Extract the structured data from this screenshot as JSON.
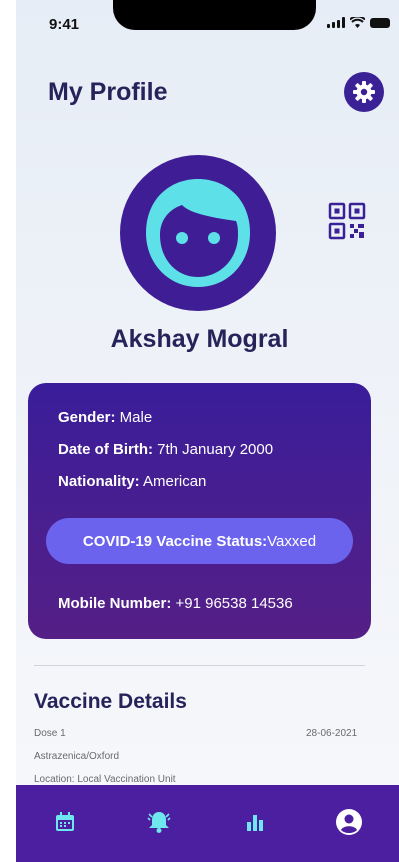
{
  "status_bar": {
    "time": "9:41"
  },
  "header": {
    "title": "My Profile"
  },
  "profile": {
    "name": "Akshay Mogral"
  },
  "info_card": {
    "gender_label": "Gender:",
    "gender_value": " Male",
    "dob_label": "Date of Birth:",
    "dob_value": " 7th January 2000",
    "nationality_label": "Nationality:",
    "nationality_value": " American",
    "vaccine_status_label": "COVID-19 Vaccine Status:",
    "vaccine_status_value": " Vaxxed",
    "mobile_label": "Mobile Number:",
    "mobile_value": " +91 96538 14536"
  },
  "vaccine_details": {
    "title": "Vaccine Details",
    "dose": "Dose 1",
    "date": "28-06-2021",
    "vaccine": "Astrazenica/Oxford",
    "location": "Location: Local Vaccination Unit"
  },
  "colors": {
    "accent": "#3b2196",
    "face": "#5ee0e8",
    "pill": "#6b63ee",
    "tab_icon": "#6ee7ee"
  },
  "tab_icons": [
    "calendar-icon",
    "bell-icon",
    "bar-chart-icon",
    "user-circle-icon"
  ]
}
